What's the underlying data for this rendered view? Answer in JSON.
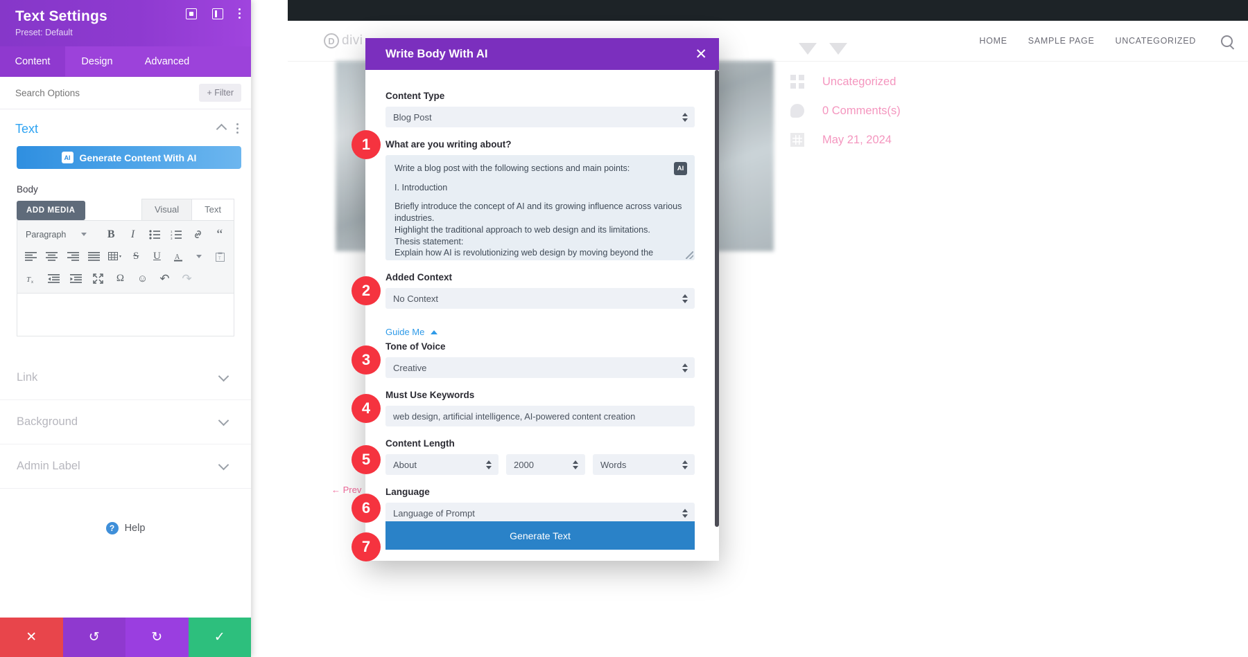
{
  "site": {
    "logo_mark": "D",
    "logo_word": "divi",
    "nav": [
      {
        "label": "HOME"
      },
      {
        "label": "SAMPLE PAGE"
      },
      {
        "label": "UNCATEGORIZED"
      }
    ],
    "search_icon": "search-icon",
    "post_meta": [
      {
        "icon": "category-icon",
        "text": "Uncategorized"
      },
      {
        "icon": "comment-icon",
        "text": "0 Comments(s)"
      },
      {
        "icon": "calendar-icon",
        "text": "May 21, 2024"
      }
    ],
    "prev_link": "← Prev"
  },
  "sidebar": {
    "title": "Text Settings",
    "preset": "Preset: Default",
    "header_icons": [
      "focus-icon",
      "panel-layout-icon",
      "kebab-menu-icon"
    ],
    "tabs": [
      {
        "label": "Content",
        "active": true
      },
      {
        "label": "Design",
        "active": false
      },
      {
        "label": "Advanced",
        "active": false
      }
    ],
    "search": {
      "placeholder": "Search Options",
      "value": ""
    },
    "filter_label": "+ Filter",
    "section": {
      "title": "Text",
      "ai_button": "Generate Content With AI",
      "ai_badge": "AI"
    },
    "body_label": "Body",
    "editor": {
      "add_media": "ADD MEDIA",
      "tabs": [
        {
          "label": "Visual",
          "active": true
        },
        {
          "label": "Text",
          "active": false
        }
      ],
      "format_select": "Paragraph",
      "toolbar_row1": [
        {
          "name": "bold-icon",
          "glyph": "B"
        },
        {
          "name": "italic-icon",
          "glyph": "I"
        },
        {
          "name": "bulleted-list-icon",
          "glyph": "☰"
        },
        {
          "name": "numbered-list-icon",
          "glyph": "≣"
        },
        {
          "name": "link-icon",
          "glyph": "ὑ7"
        },
        {
          "name": "blockquote-icon",
          "glyph": "“"
        }
      ],
      "toolbar_row2": [
        {
          "name": "align-left-icon",
          "glyph": "≡"
        },
        {
          "name": "align-center-icon",
          "glyph": "≡"
        },
        {
          "name": "align-right-icon",
          "glyph": "≡"
        },
        {
          "name": "align-justify-icon",
          "glyph": "≡"
        },
        {
          "name": "table-icon",
          "glyph": "⊞"
        },
        {
          "name": "strikethrough-icon",
          "glyph": "S"
        },
        {
          "name": "underline-icon",
          "glyph": "U"
        },
        {
          "name": "text-color-icon",
          "glyph": "A"
        },
        {
          "name": "paste-as-text-icon",
          "glyph": "ὌB"
        }
      ],
      "toolbar_row3": [
        {
          "name": "clear-formatting-icon",
          "glyph": "T"
        },
        {
          "name": "outdent-icon",
          "glyph": "←"
        },
        {
          "name": "indent-icon",
          "glyph": "→"
        },
        {
          "name": "fullscreen-icon",
          "glyph": "⤢"
        },
        {
          "name": "special-character-icon",
          "glyph": "Ω"
        },
        {
          "name": "emoji-icon",
          "glyph": "☺"
        },
        {
          "name": "undo-icon",
          "glyph": "↶"
        },
        {
          "name": "redo-icon",
          "glyph": "↷"
        }
      ]
    },
    "accordions": [
      {
        "label": "Link"
      },
      {
        "label": "Background"
      },
      {
        "label": "Admin Label"
      }
    ],
    "help": "Help",
    "footer_buttons": [
      {
        "name": "discard-button",
        "glyph": "✕"
      },
      {
        "name": "undo-button",
        "glyph": "↺"
      },
      {
        "name": "redo-button",
        "glyph": "↻"
      },
      {
        "name": "save-button",
        "glyph": "✓"
      }
    ]
  },
  "modal": {
    "title": "Write Body With AI",
    "close_glyph": "✕",
    "content_type": {
      "label": "Content Type",
      "value": "Blog Post"
    },
    "prompt": {
      "label": "What are you writing about?",
      "badge": "AI",
      "line1": "Write a blog post with the following sections and main points:",
      "line2": "I. Introduction",
      "line3": "Briefly introduce the concept of AI and its growing influence across various industries.",
      "line4": "Highlight the traditional approach to web design and its limitations.",
      "line5": "Thesis statement:",
      "line6": "Explain how AI is revolutionizing web design by moving beyond the"
    },
    "added_context": {
      "label": "Added Context",
      "value": "No Context"
    },
    "guide_me": "Guide Me",
    "tone": {
      "label": "Tone of Voice",
      "value": "Creative"
    },
    "keywords": {
      "label": "Must Use Keywords",
      "value": "web design, artificial intelligence, AI-powered content creation"
    },
    "content_length": {
      "label": "Content Length",
      "approx": "About",
      "amount": "2000",
      "unit": "Words"
    },
    "language": {
      "label": "Language",
      "value": "Language of Prompt"
    },
    "generate_button": "Generate Text"
  },
  "callouts": [
    {
      "n": "1"
    },
    {
      "n": "2"
    },
    {
      "n": "3"
    },
    {
      "n": "4"
    },
    {
      "n": "5"
    },
    {
      "n": "6"
    },
    {
      "n": "7"
    }
  ],
  "colors": {
    "divi_purple": "#8f39cf",
    "modal_purple": "#7b2fbe",
    "accent_blue": "#2a82c8",
    "callout_red": "#f5333f",
    "meta_pink": "#ec3f8a"
  }
}
